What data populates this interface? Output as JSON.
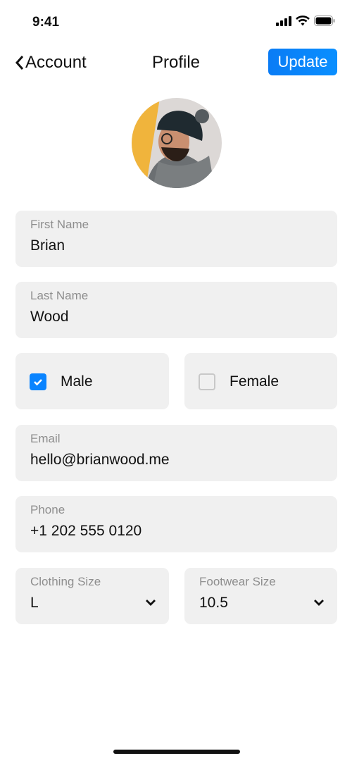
{
  "status_bar": {
    "time": "9:41",
    "icons": [
      "signal-icon",
      "wifi-icon",
      "battery-icon"
    ]
  },
  "nav": {
    "back_label": "Account",
    "title": "Profile",
    "update_label": "Update",
    "accent": "#0a84ff"
  },
  "form": {
    "first_name": {
      "label": "First Name",
      "value": "Brian"
    },
    "last_name": {
      "label": "Last Name",
      "value": "Wood"
    },
    "gender": {
      "male": {
        "label": "Male",
        "checked": true
      },
      "female": {
        "label": "Female",
        "checked": false
      }
    },
    "email": {
      "label": "Email",
      "value": "hello@brianwood.me"
    },
    "phone": {
      "label": "Phone",
      "value": "+1 202 555 0120"
    },
    "clothing": {
      "label": "Clothing Size",
      "value": "L"
    },
    "footwear": {
      "label": "Footwear Size",
      "value": "10.5"
    }
  }
}
